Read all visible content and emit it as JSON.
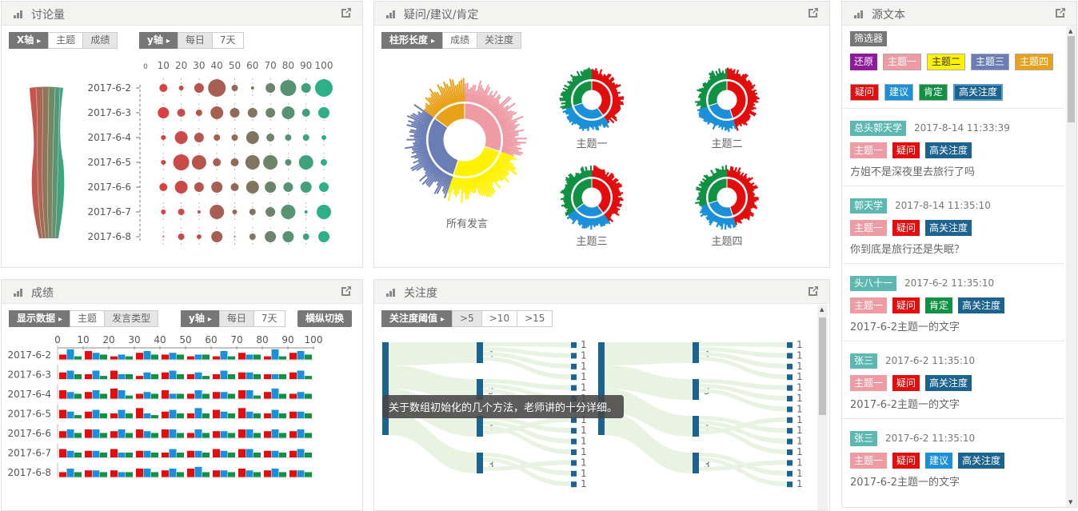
{
  "panels": {
    "discussion": {
      "title": "讨论量",
      "xaxis_buttons": [
        "X轴",
        "主题",
        "成绩"
      ],
      "yaxis_buttons": [
        "y轴",
        "每日",
        "7天"
      ]
    },
    "questions": {
      "title": "疑问/建议/肯定",
      "bar_buttons": [
        "柱形长度",
        "成绩",
        "关注度"
      ],
      "main_caption": "所有发言",
      "sub_captions": [
        "主题一",
        "主题二",
        "主题三",
        "主题四"
      ]
    },
    "source": {
      "title": "源文本",
      "filter_label": "筛选器",
      "filter_topics": [
        "还原",
        "主题一",
        "主题二",
        "主题三",
        "主题四"
      ],
      "filter_types": [
        "疑问",
        "建议",
        "肯定",
        "高关注度"
      ]
    },
    "grades": {
      "title": "成绩",
      "display_buttons": [
        "显示数据",
        "主题",
        "发言类型"
      ],
      "yaxis_buttons": [
        "y轴",
        "每日",
        "7天"
      ],
      "toggle_label": "横纵切换"
    },
    "attention": {
      "title": "关注度",
      "threshold_buttons": [
        "关注度阈值",
        ">5",
        ">10",
        ">15"
      ],
      "tooltip": "关于数组初始化的几个方法，老师讲的十分详细。"
    }
  },
  "colors": {
    "topic1": "#ee9ba4",
    "topic2": "#fff200",
    "topic3": "#6a7db5",
    "topic4": "#e8a21a",
    "restore": "#8e1a9c",
    "question": "#e30d0d",
    "suggest": "#1b90d8",
    "affirm": "#119144",
    "high": "#1c6390",
    "tag_gray": "#777777"
  },
  "messages": [
    {
      "name": "总头郭天学",
      "time": "2017-8-14 11:33:39",
      "tags": [
        "主题一",
        "疑问",
        "高关注度"
      ],
      "text": "方姐不是深夜里去旅行了吗"
    },
    {
      "name": "郭天学",
      "time": "2017-8-14 11:35:10",
      "tags": [
        "主题一",
        "疑问",
        "高关注度"
      ],
      "text": "你到底是旅行还是失眠？"
    },
    {
      "name": "头八十一",
      "time": "2017-6-2 11:35:10",
      "tags": [
        "主题一",
        "疑问",
        "肯定",
        "高关注度"
      ],
      "text": "2017-6-2主题一的文字"
    },
    {
      "name": "张三",
      "time": "2017-6-2 11:35:10",
      "tags": [
        "主题一",
        "疑问",
        "高关注度"
      ],
      "text": "2017-6-2主题一的文字"
    },
    {
      "name": "张三",
      "time": "2017-6-2 11:35:10",
      "tags": [
        "主题一",
        "疑问",
        "建议",
        "高关注度"
      ],
      "text": "2017-6-2主题一的文字"
    }
  ],
  "chart_data": [
    {
      "type": "scatter",
      "name_hint": "discussion",
      "x_ticks": [
        "0",
        "10",
        "20",
        "30",
        "40",
        "50",
        "60",
        "70",
        "80",
        "90",
        "100"
      ],
      "categories": [
        "2017-6-2",
        "2017-6-3",
        "2017-6-4",
        "2017-6-5",
        "2017-6-6",
        "2017-6-7",
        "2017-6-8"
      ],
      "columns": [
        0,
        10,
        20,
        30,
        40,
        50,
        60,
        70,
        80,
        90,
        100
      ],
      "sizes": [
        [
          0,
          5,
          3,
          6,
          11,
          4,
          2,
          6,
          10,
          6,
          11
        ],
        [
          0,
          7,
          5,
          4,
          8,
          6,
          6,
          6,
          8,
          5,
          7
        ],
        [
          0,
          3,
          8,
          6,
          4,
          4,
          8,
          5,
          4,
          4,
          3
        ],
        [
          0,
          3,
          10,
          9,
          5,
          5,
          9,
          9,
          4,
          9,
          4
        ],
        [
          0,
          5,
          8,
          6,
          7,
          5,
          8,
          7,
          6,
          7,
          6
        ],
        [
          0,
          3,
          4,
          2,
          9,
          3,
          4,
          6,
          9,
          2,
          9
        ],
        [
          0,
          1,
          4,
          3,
          7,
          1,
          4,
          7,
          7,
          4,
          7
        ]
      ]
    },
    {
      "type": "bar",
      "name_hint": "grades",
      "x_ticks": [
        "0",
        "10",
        "20",
        "30",
        "40",
        "50",
        "60",
        "70",
        "80",
        "90",
        "100"
      ],
      "categories": [
        "2017-6-2",
        "2017-6-3",
        "2017-6-4",
        "2017-6-5",
        "2017-6-6",
        "2017-6-7",
        "2017-6-8"
      ],
      "series": [
        {
          "values": [
            [
              3,
              5,
              2,
              4,
              3,
              2,
              2,
              4,
              2,
              4
            ],
            [
              4,
              3,
              5,
              2,
              4,
              3,
              3,
              4,
              3,
              4
            ],
            [
              5,
              4,
              6,
              3,
              5,
              3,
              4,
              5,
              4,
              3
            ],
            [
              5,
              4,
              3,
              6,
              4,
              3,
              5,
              6,
              3,
              4
            ],
            [
              4,
              5,
              4,
              5,
              5,
              3,
              4,
              5,
              4,
              4
            ],
            [
              5,
              4,
              5,
              4,
              3,
              4,
              5,
              5,
              4,
              4
            ],
            [
              3,
              4,
              4,
              5,
              4,
              5,
              4,
              5,
              4,
              4
            ]
          ]
        },
        {
          "values": [
            [
              6,
              4,
              3,
              5,
              4,
              3,
              5,
              3,
              6,
              5
            ],
            [
              5,
              5,
              3,
              4,
              5,
              4,
              5,
              4,
              3,
              5
            ],
            [
              4,
              5,
              5,
              4,
              3,
              5,
              4,
              5,
              6,
              4
            ],
            [
              4,
              5,
              5,
              3,
              5,
              6,
              4,
              4,
              5,
              4
            ],
            [
              5,
              5,
              5,
              4,
              5,
              5,
              4,
              5,
              5,
              5
            ],
            [
              4,
              4,
              3,
              4,
              5,
              4,
              4,
              5,
              4,
              5
            ],
            [
              5,
              4,
              3,
              5,
              5,
              6,
              4,
              4,
              5,
              4
            ]
          ]
        },
        {
          "values": [
            [
              2,
              3,
              2,
              3,
              3,
              3,
              2,
              3,
              2,
              3
            ],
            [
              3,
              2,
              3,
              3,
              3,
              2,
              3,
              3,
              3,
              2
            ],
            [
              3,
              3,
              2,
              3,
              3,
              3,
              3,
              2,
              3,
              3
            ],
            [
              2,
              3,
              3,
              2,
              3,
              3,
              3,
              3,
              3,
              3
            ],
            [
              3,
              3,
              3,
              3,
              3,
              3,
              3,
              3,
              3,
              3
            ],
            [
              3,
              3,
              3,
              3,
              3,
              3,
              3,
              3,
              3,
              3
            ],
            [
              3,
              3,
              3,
              3,
              3,
              3,
              3,
              3,
              3,
              3
            ]
          ]
        }
      ]
    },
    {
      "type": "sankey",
      "name_hint": "attention",
      "left_nodes": [
        "14",
        "14"
      ],
      "middle_nodes": [
        "4",
        "3",
        "4",
        "3",
        "4",
        "3",
        "4",
        "3"
      ],
      "right_nodes": [
        "1",
        "1",
        "1",
        "1",
        "1",
        "1",
        "1",
        "1",
        "1",
        "1",
        "1",
        "1",
        "1",
        "1"
      ]
    }
  ]
}
